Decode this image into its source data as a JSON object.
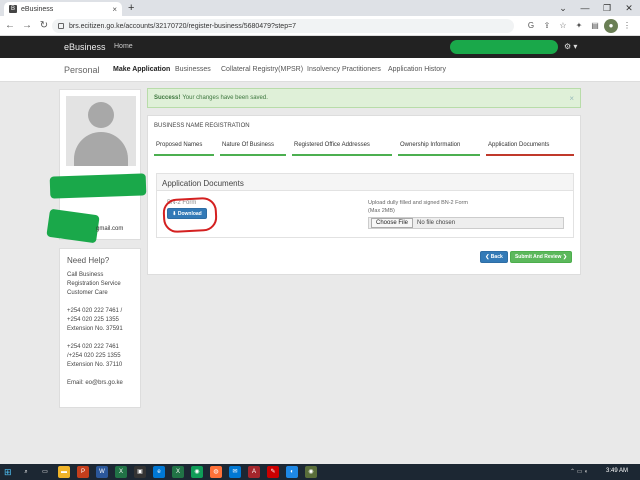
{
  "browser": {
    "tab_title": "eBusiness",
    "url": "brs.ecitizen.go.ke/accounts/32170720/register-business/5680479?step=7",
    "tab_close": "×",
    "new_tab": "+",
    "window_controls": [
      "⌄",
      "—",
      "❐",
      "✕"
    ]
  },
  "header": {
    "brand": "eBusiness",
    "home": "Home",
    "settings_caret": "⚙ ▾"
  },
  "subnav": {
    "personal": "Personal",
    "items": [
      "Make Application",
      "Businesses",
      "Collateral Registry(MPSR)",
      "Insolvency Practitioners",
      "Application History"
    ]
  },
  "profile": {
    "email_suffix": "gmail.com"
  },
  "help": {
    "title": "Need Help?",
    "lines1": [
      "Call Business",
      "Registration Service",
      "Customer Care"
    ],
    "lines2": [
      "+254 020 222 7461 /",
      "+254 020 225 1355",
      "Extension No. 37591"
    ],
    "lines3": [
      "+254 020 222 7461",
      "/+254 020 225 1355",
      "Extension No. 37110"
    ],
    "email": "Email: eo@brs.go.ke"
  },
  "alert": {
    "strong": "Success!",
    "message": "Your changes have been saved.",
    "close": "×"
  },
  "panel": {
    "heading": "BUSINESS NAME REGISTRATION",
    "steps": [
      "Proposed Names",
      "Nature Of Business",
      "Registered Office Addresses",
      "Ownership Information",
      "Application Documents"
    ],
    "docs_title": "Application Documents",
    "form_label": "BN-2 Form",
    "download": "⬇ Download",
    "upload_label_1": "Upload dully filled and signed BN-2 Form",
    "upload_label_2": "(Max 2MB)",
    "choose_file": "Choose File",
    "no_file": "No file chosen",
    "back": "❮ Back",
    "submit": "Submit And Review ❯"
  },
  "taskbar": {
    "time": "3:49 AM"
  },
  "colors": {
    "header_bg": "#222222",
    "success_bg": "#dff0d8",
    "primary": "#337ab7",
    "success": "#5cb85c",
    "annotation_red": "#d42020",
    "redaction_green": "#1aa84a"
  }
}
